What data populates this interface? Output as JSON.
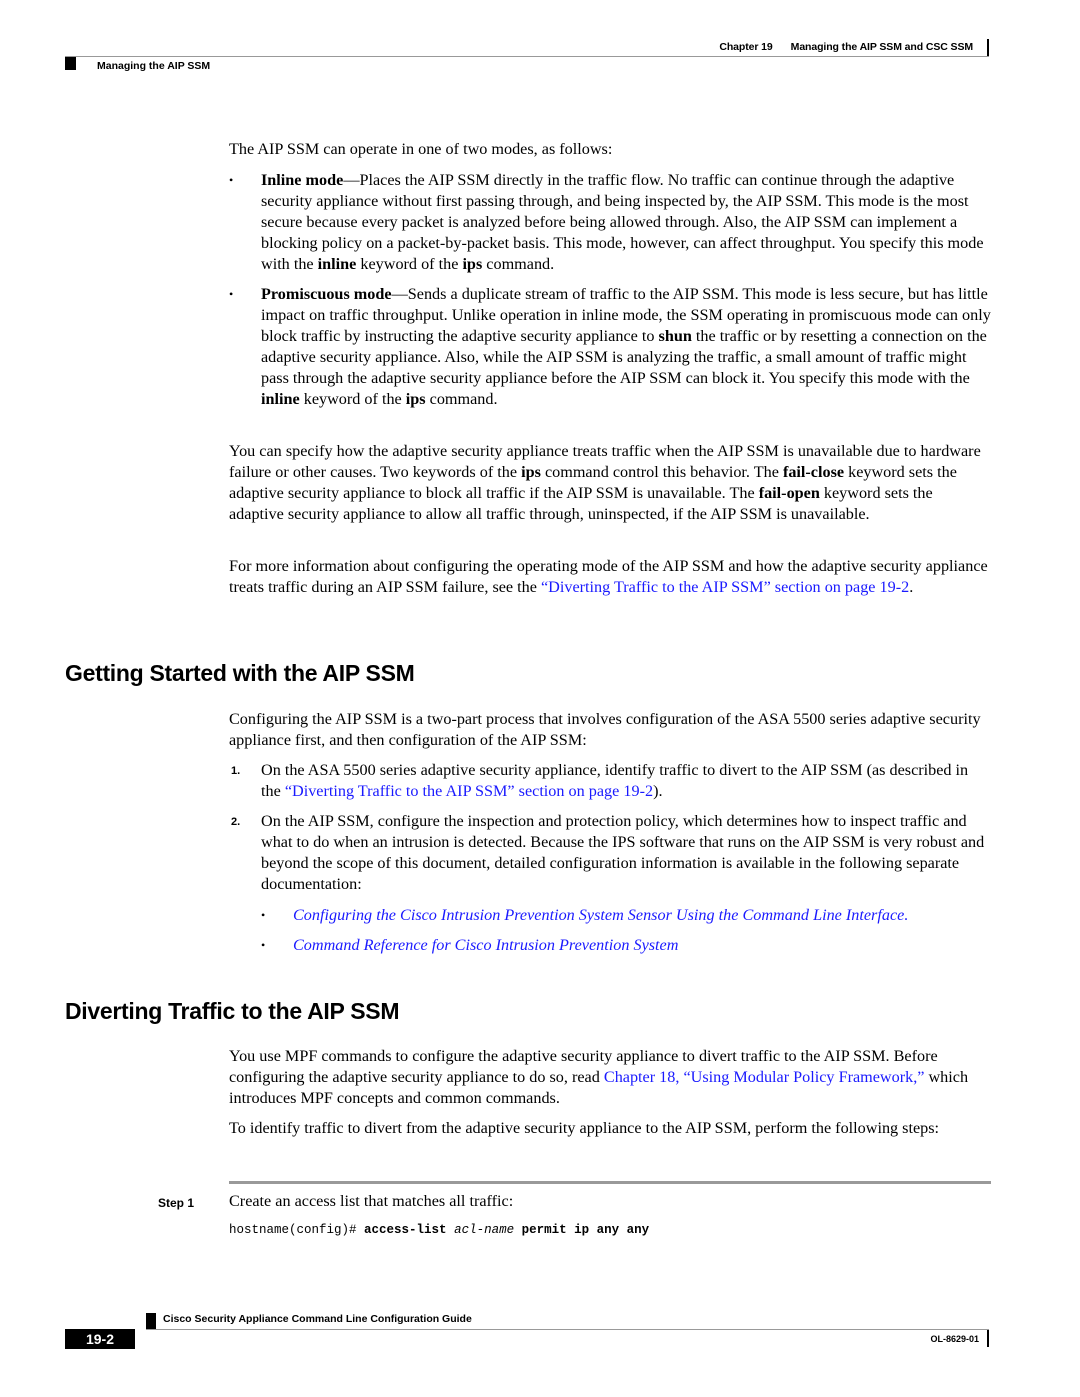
{
  "header": {
    "chapter_label": "Chapter 19",
    "chapter_title": "Managing the AIP SSM and CSC SSM",
    "section_title": "Managing the AIP SSM"
  },
  "intro": {
    "text": "The AIP SSM can operate in one of two modes, as follows:"
  },
  "modes": [
    {
      "term": "Inline mode",
      "text_1": "—Places the AIP SSM directly in the traffic flow. No traffic can continue through the adaptive security appliance without first passing through, and being inspected by, the AIP SSM. This mode is the most secure because every packet is analyzed before being allowed through. Also, the AIP SSM can implement a blocking policy on a packet-by-packet basis. This mode, however, can affect throughput. You specify this mode with the ",
      "kw_1": "inline",
      "text_2": " keyword of the ",
      "kw_2": "ips",
      "text_3": " command."
    },
    {
      "term": "Promiscuous mode",
      "text_1": "—Sends a duplicate stream of traffic to the AIP SSM. This mode is less secure, but has little impact on traffic throughput. Unlike operation in inline mode, the SSM operating in promiscuous mode can only block traffic by instructing the adaptive security appliance to ",
      "kw_shun": "shun",
      "text_2": " the traffic or by resetting a connection on the adaptive security appliance. Also, while the AIP SSM is analyzing the traffic, a small amount of traffic might pass through the adaptive security appliance before the AIP SSM can block it. You specify this mode with the ",
      "kw_1": "inline",
      "text_3": " keyword of the ",
      "kw_2": "ips",
      "text_4": " command."
    }
  ],
  "failover_para": {
    "t1": "You can specify how the adaptive security appliance treats traffic when the AIP SSM is unavailable due to hardware failure or other causes. Two keywords of the ",
    "kw_ips": "ips",
    "t2": " command control this behavior. The ",
    "kw_close": "fail-close",
    "t3": " keyword sets the adaptive security appliance to block all traffic if the AIP SSM is unavailable. The ",
    "kw_open": "fail-open",
    "t4": " keyword sets the adaptive security appliance to allow all traffic through, uninspected, if the AIP SSM is unavailable."
  },
  "more_info_para": {
    "t1": "For more information about configuring the operating mode of the AIP SSM and how the adaptive security appliance treats traffic during an AIP SSM failure, see the ",
    "link": "“Diverting Traffic to the AIP SSM” section on page 19-2",
    "t2": "."
  },
  "section_getting_started": {
    "heading": "Getting Started with the AIP SSM",
    "intro": "Configuring the AIP SSM is a two-part process that involves configuration of the ASA 5500 series adaptive security appliance first, and then configuration of the AIP SSM:",
    "steps": [
      {
        "num": "1.",
        "t1": "On the ASA 5500 series adaptive security appliance, identify traffic to divert to the AIP SSM (as described in the ",
        "link": "“Diverting Traffic to the AIP SSM” section on page 19-2",
        "t2": ")."
      },
      {
        "num": "2.",
        "t1": "On the AIP SSM, configure the inspection and protection policy, which determines how to inspect traffic and what to do when an intrusion is detected. Because the IPS software that runs on the AIP SSM is very robust and beyond the scope of this document, detailed configuration information is available in the following separate documentation:"
      }
    ],
    "doc_links": [
      "Configuring the Cisco Intrusion Prevention System Sensor Using the Command Line Interface.",
      "Command Reference for Cisco Intrusion Prevention System"
    ]
  },
  "section_diverting": {
    "heading": "Diverting Traffic to the AIP SSM",
    "para1_t1": "You use MPF commands to configure the adaptive security appliance to divert traffic to the AIP SSM. Before configuring the adaptive security appliance to do so, read ",
    "para1_link": "Chapter 18, “Using Modular Policy Framework,”",
    "para1_t2": " which introduces MPF concepts and common commands.",
    "para2": "To identify traffic to divert from the adaptive security appliance to the AIP SSM, perform the following steps:",
    "step_label": "Step 1",
    "step_text": "Create an access list that matches all traffic:",
    "code": {
      "prompt": "hostname(config)# ",
      "cmd": "access-list",
      "arg": "acl-name",
      "rest": "permit ip any any"
    }
  },
  "footer": {
    "guide_title": "Cisco Security Appliance Command Line Configuration Guide",
    "page_number": "19-2",
    "doc_number": "OL-8629-01"
  },
  "colors": {
    "link": "#1a1aff",
    "rule": "#999999",
    "text": "#000000"
  }
}
